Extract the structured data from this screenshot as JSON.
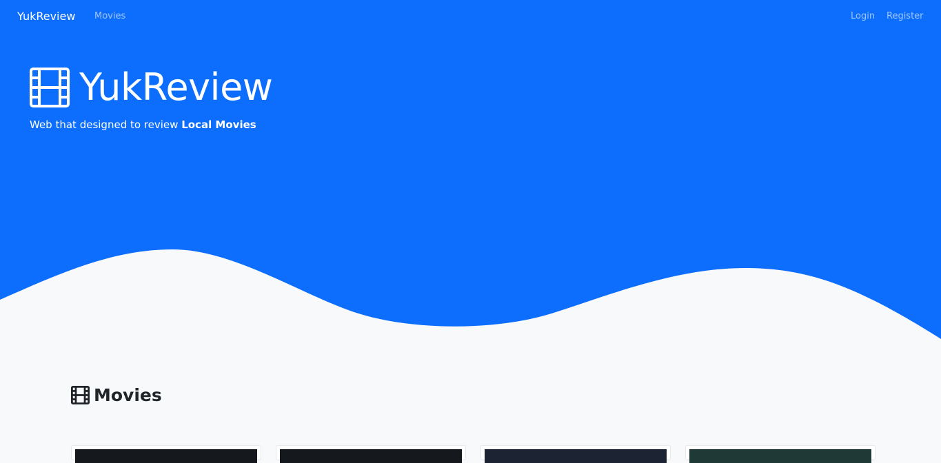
{
  "navbar": {
    "brand": "YukReview",
    "links": [
      "Movies"
    ],
    "auth": {
      "login": "Login",
      "register": "Register"
    }
  },
  "hero": {
    "title": "YukReview",
    "subtitle_prefix": "Web that designed to review ",
    "subtitle_bold": "Local Movies",
    "icon": "film-icon"
  },
  "movies_section": {
    "title": "Movies",
    "icon": "film-icon",
    "card_count": 4
  },
  "colors": {
    "primary": "#0d6efd",
    "background": "#f8f9fa",
    "heading": "#212529"
  }
}
